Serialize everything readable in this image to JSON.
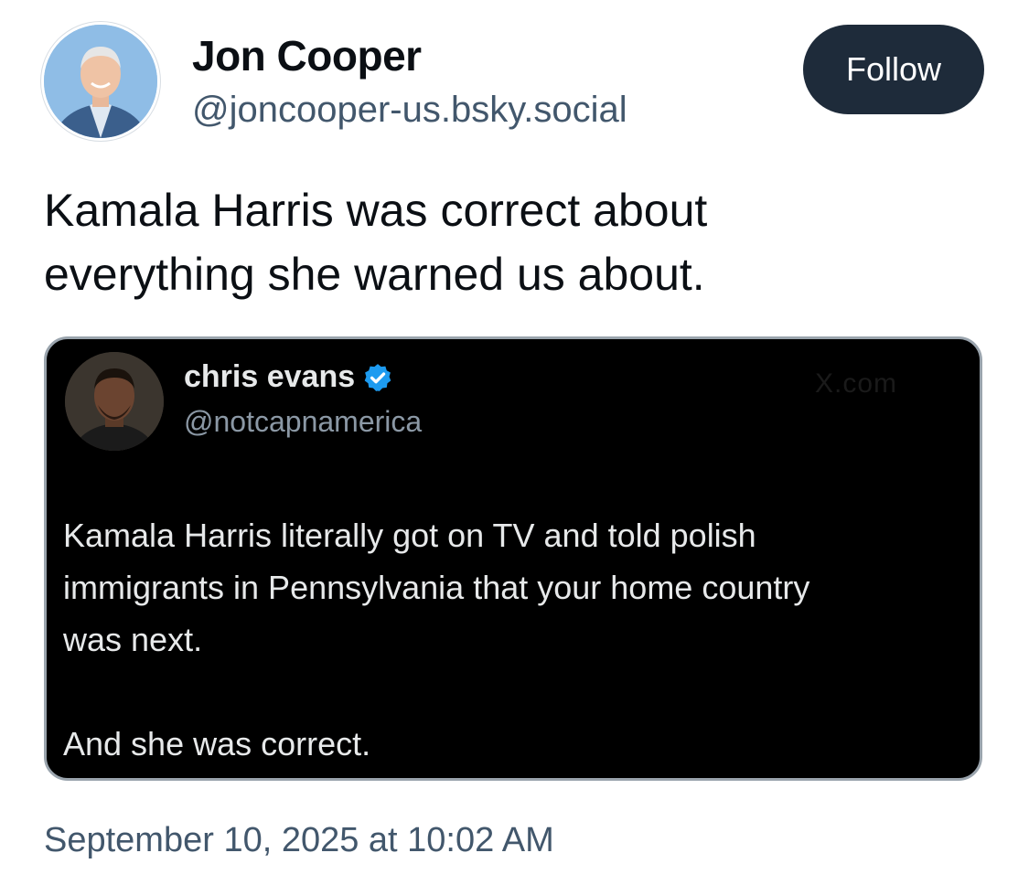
{
  "author": {
    "display_name": "Jon Cooper",
    "handle": "@joncooper-us.bsky.social"
  },
  "follow_label": "Follow",
  "post": {
    "text_lines": [
      "Kamala Harris was correct about",
      "everything she warned us about."
    ]
  },
  "embedded_post": {
    "display_name": "chris evans",
    "handle": "@notcapnamerica",
    "watermark": "X.com",
    "paragraph_1_lines": [
      "Kamala Harris literally got on TV and told polish",
      "immigrants in Pennsylvania that your home country",
      "was next."
    ],
    "paragraph_2_lines": [
      "And she was correct."
    ]
  },
  "timestamp": "September 10, 2025 at 10:02 AM",
  "colors": {
    "follow_button_bg": "#1e2b3a",
    "handle_text": "#42576c",
    "verified_badge": "#1d9bf0",
    "embed_bg": "#000000"
  },
  "icons": {
    "verified": "verified-badge-icon"
  }
}
